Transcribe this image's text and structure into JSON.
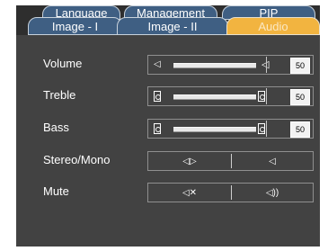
{
  "tabs": {
    "row1": [
      "Language",
      "Management",
      "PIP"
    ],
    "row2": [
      "Image - I",
      "Image - II",
      "Audio"
    ],
    "active": "Audio"
  },
  "settings": [
    {
      "label": "Volume",
      "value": "50"
    },
    {
      "label": "Treble",
      "value": "50"
    },
    {
      "label": "Bass",
      "value": "50"
    },
    {
      "label": "Stereo/Mono",
      "options": [
        "stereo-icon",
        "mono-icon"
      ]
    },
    {
      "label": "Mute",
      "options": [
        "mute-on-icon",
        "mute-off-icon"
      ]
    }
  ],
  "colors": {
    "tab_blue": "#3f5f83",
    "tab_active": "#f2b440",
    "panel_bg": "#424242"
  }
}
